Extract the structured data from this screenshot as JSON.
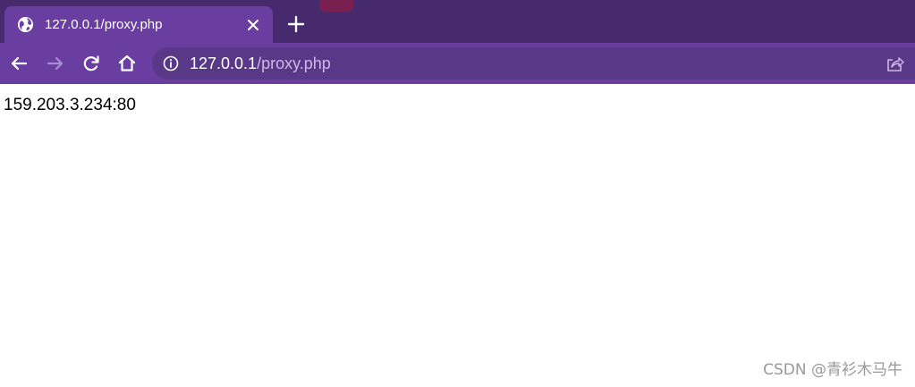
{
  "browser": {
    "tab": {
      "title": "127.0.0.1/proxy.php",
      "favicon": "globe-icon",
      "close": "close-icon"
    },
    "new_tab": "plus-icon",
    "toolbar": {
      "back": "arrow-left-icon",
      "forward": "arrow-right-icon",
      "reload": "reload-icon",
      "home": "home-icon"
    },
    "omnibox": {
      "info": "info-icon",
      "url_host": "127.0.0.1",
      "url_path": "/proxy.php",
      "share": "share-icon"
    },
    "colors": {
      "tabstrip": "#47296e",
      "active_tab": "#6a3ea1",
      "omnibox": "#593888"
    }
  },
  "page": {
    "content": "159.203.3.234:80"
  },
  "watermark": "CSDN @青衫木马牛"
}
